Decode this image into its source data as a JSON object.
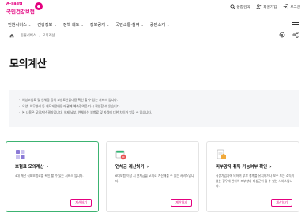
{
  "logo": {
    "small": "A-saeti",
    "name": "국민건강보험"
  },
  "util": {
    "search": "통합검색",
    "join": "회원가입",
    "login": "로그인"
  },
  "gnb": [
    "민원서비스",
    "건강정보",
    "정책 제도",
    "정보공개",
    "국민소통·참여",
    "공단소개"
  ],
  "breadcrumb": {
    "level1": "민원서비스",
    "level2": "모의계산"
  },
  "page_title": "모의계산",
  "notice": [
    "예상보험료 및 연체금 등의 보험료산출내용 확인 할 수 있는 서비스 입니다.",
    "요양, 의무영리 등 제도개정내용과 관계 예측정액을 다시 확인할 수 있습니다.",
    "본 내용은 모의계산 결과입니다. 실제 납부, 연체하는 보험료 및 자격에 대한 차이가 있을 수 있습니다."
  ],
  "cards": [
    {
      "title": "보험료 모의계산",
      "desc": "4대 재산 식표보험료를 확인 할 수 있는 서비스 입니다.",
      "button": "계산하기",
      "icon": "calculator-icon"
    },
    {
      "title": "연체금 계산하기",
      "desc": "6대보험 이상 시 연체금을 모의로 계산해볼 수 있는 서비스입니다.",
      "button": "계산하기",
      "icon": "overdue-calendar-icon"
    },
    {
      "title": "피부양자 취득 가능여부 확인",
      "desc": "직장가입자에 의하여 부부 생계를 유지하거나 보수 또는 소득이 없는 경우에 한하여 피부양자 대상군이 될 수 있는 서비스입니다.",
      "button": "계산하기",
      "icon": "dependent-document-icon"
    }
  ],
  "colors": {
    "brand": "#e4007f",
    "active_border": "#3cb371"
  }
}
